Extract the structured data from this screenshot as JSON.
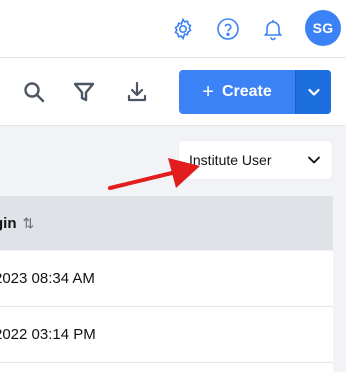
{
  "header": {
    "icons": [
      "gear-icon",
      "help-icon",
      "bell-icon"
    ],
    "avatar_initials": "SG"
  },
  "toolbar": {
    "icons": [
      "search-icon",
      "filter-icon",
      "download-icon"
    ],
    "create_label": "Create"
  },
  "user_type_select": {
    "value": "Institute User"
  },
  "table": {
    "column_header": "gin",
    "rows": [
      "2023 08:34 AM",
      "2022 03:14 PM"
    ]
  },
  "colors": {
    "accent": "#3b82f6",
    "accent_dark": "#1d6fe0",
    "annotation_arrow": "#e11d1d"
  }
}
